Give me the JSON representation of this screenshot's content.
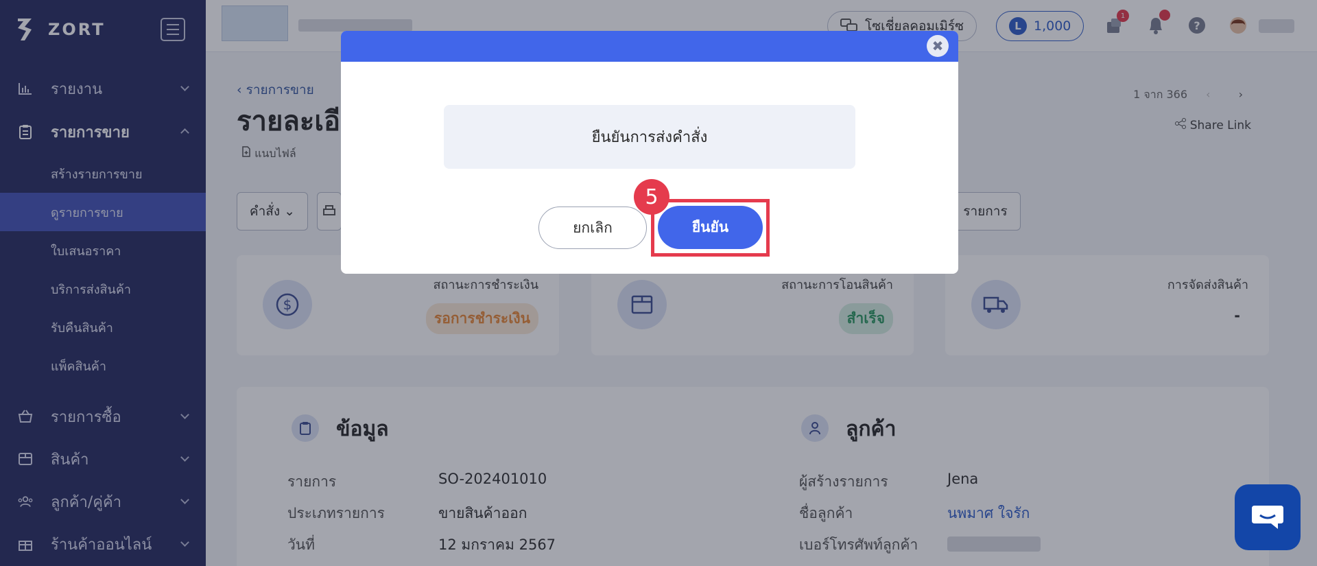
{
  "brand": {
    "name": "ZORT"
  },
  "sidebar": {
    "items": [
      {
        "label": "รายงาน",
        "icon": "bar-chart-icon"
      },
      {
        "label": "รายการขาย",
        "icon": "clipboard-icon"
      },
      {
        "label": "รายการซื้อ",
        "icon": "basket-icon"
      },
      {
        "label": "สินค้า",
        "icon": "box-icon"
      },
      {
        "label": "ลูกค้า/คู่ค้า",
        "icon": "users-icon"
      },
      {
        "label": "ร้านค้าออนไลน์",
        "icon": "gift-icon"
      }
    ],
    "sub_items": [
      {
        "label": "สร้างรายการขาย"
      },
      {
        "label": "ดูรายการขาย"
      },
      {
        "label": "ใบเสนอราคา"
      },
      {
        "label": "บริการส่งสินค้า"
      },
      {
        "label": "รับคืนสินค้า"
      },
      {
        "label": "แพ็คสินค้า"
      }
    ]
  },
  "topbar": {
    "social_label": "โซเชี่ยลคอมเมิร์ซ",
    "coins": "1,000",
    "coin_letter": "L",
    "notif_count": "1"
  },
  "main": {
    "breadcrumb": "รายการขาย",
    "title": "รายละเอี",
    "attach_label": "แนบไฟล์",
    "pager": "1 จาก 366",
    "share_link": "Share Link",
    "command_button": "คำสั่ง",
    "right_button": "รายการ",
    "cards": [
      {
        "label": "สถานะการชำระเงิน",
        "value": "รอการชำระเงิน",
        "value_color": "#e8893a",
        "value_bg": "#fbead7"
      },
      {
        "label": "สถานะการโอนสินค้า",
        "value": "สำเร็จ",
        "value_color": "#2f9a63",
        "value_bg": "#d6efe1"
      },
      {
        "label": "การจัดส่งสินค้า",
        "value": "-"
      }
    ],
    "info_section": {
      "title": "ข้อมูล",
      "rows": [
        {
          "label": "รายการ",
          "value": "SO-202401010"
        },
        {
          "label": "ประเภทรายการ",
          "value": "ขายสินค้าออก"
        },
        {
          "label": "วันที่",
          "value": "12 มกราคม 2567"
        }
      ]
    },
    "customer_section": {
      "title": "ลูกค้า",
      "rows": [
        {
          "label": "ผู้สร้างรายการ",
          "value": "Jena"
        },
        {
          "label": "ชื่อลูกค้า",
          "value": "นพมาศ ใจรัก"
        },
        {
          "label": "เบอร์โทรศัพท์ลูกค้า",
          "value": ""
        }
      ]
    }
  },
  "modal": {
    "message": "ยืนยันการส่งคำสั่ง",
    "cancel_label": "ยกเลิก",
    "confirm_label": "ยืนยัน",
    "step_number": "5",
    "close_glyph": "✖"
  },
  "colors": {
    "sidebar_bg": "#2b2f63",
    "accent": "#4166ea",
    "highlight": "#e53b4d",
    "chat_button": "#1346a8"
  }
}
